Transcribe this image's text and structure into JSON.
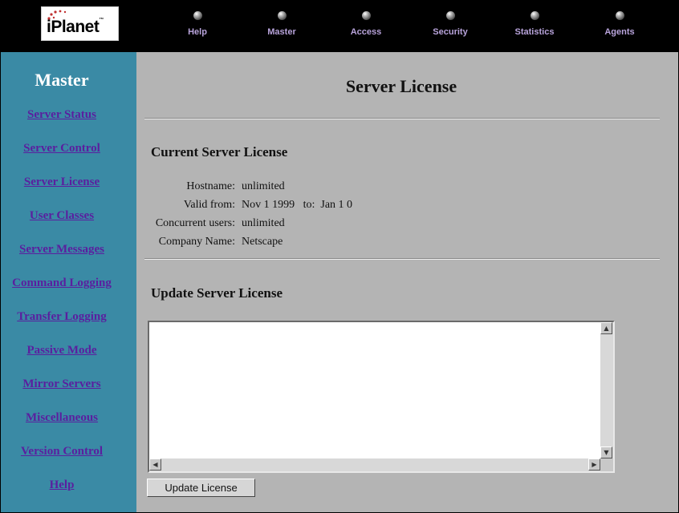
{
  "logo": {
    "text": "iPlanet",
    "tm": "™"
  },
  "nav": [
    {
      "label": "Help"
    },
    {
      "label": "Master"
    },
    {
      "label": "Access"
    },
    {
      "label": "Security"
    },
    {
      "label": "Statistics"
    },
    {
      "label": "Agents"
    }
  ],
  "sidebar": {
    "title": "Master",
    "items": [
      {
        "label": "Server Status"
      },
      {
        "label": "Server Control"
      },
      {
        "label": "Server License"
      },
      {
        "label": "User Classes"
      },
      {
        "label": "Server Messages"
      },
      {
        "label": "Command Logging"
      },
      {
        "label": "Transfer Logging"
      },
      {
        "label": "Passive Mode"
      },
      {
        "label": "Mirror Servers"
      },
      {
        "label": "Miscellaneous"
      },
      {
        "label": "Version Control"
      },
      {
        "label": "Help"
      }
    ]
  },
  "main": {
    "title": "Server License",
    "current_section": "Current Server License",
    "fields": [
      {
        "label": "Hostname:",
        "value": "unlimited"
      },
      {
        "label": "Valid from:",
        "value": "Nov 1 1999   to:  Jan 1 0"
      },
      {
        "label": "Concurrent users:",
        "value": "unlimited"
      },
      {
        "label": "Company Name:",
        "value": "Netscape"
      }
    ],
    "update_section": "Update Server License",
    "license_text": "",
    "update_button": "Update License"
  },
  "colors": {
    "sidebar_bg": "#3a8aa5",
    "main_bg": "#b4b4b4",
    "link": "#5a1f9f",
    "nav_label": "#b9a4dc"
  }
}
